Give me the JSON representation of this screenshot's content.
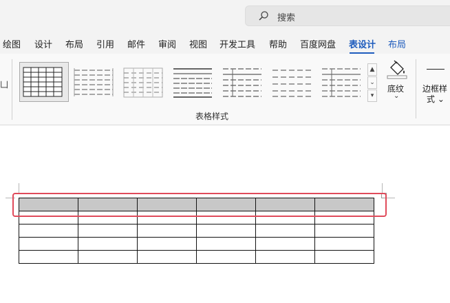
{
  "search": {
    "placeholder": "搜索",
    "icon": "search-icon"
  },
  "tabs": [
    {
      "label": "绘图"
    },
    {
      "label": "设计"
    },
    {
      "label": "布局"
    },
    {
      "label": "引用"
    },
    {
      "label": "邮件"
    },
    {
      "label": "审阅"
    },
    {
      "label": "视图"
    },
    {
      "label": "开发工具"
    },
    {
      "label": "帮助"
    },
    {
      "label": "百度网盘"
    },
    {
      "label": "表设计",
      "active": true
    },
    {
      "label": "布局",
      "contextual": true
    }
  ],
  "ribbon": {
    "left_partial_glyph": "凵",
    "table_styles_group_label": "表格样式",
    "shading": {
      "label": "底纹",
      "caret": "⌄",
      "icon": "paint-bucket-icon"
    },
    "borders": {
      "label_line1": "边框样",
      "label_line2": "式 ⌄",
      "icon": "border-line-icon"
    },
    "gallery_scroll": {
      "up": "▲",
      "down": "⌄",
      "more": "▾"
    }
  },
  "colors": {
    "accent": "#1d5bbd",
    "highlight_outline": "#e04a5a",
    "header_row_fill": "#c8c8c8"
  },
  "table": {
    "columns": 6,
    "rows": 5,
    "header_row_shaded": true
  }
}
